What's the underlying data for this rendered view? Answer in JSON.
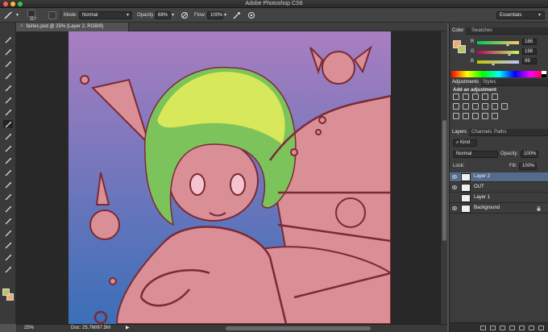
{
  "window": {
    "title": "Adobe Photoshop CS6",
    "traffic_colors": [
      "#fc5f57",
      "#fdbc2e",
      "#33c748"
    ]
  },
  "options_bar": {
    "brush_size": "117",
    "mode_label": "Mode:",
    "mode_value": "Normal",
    "opacity_label": "Opacity:",
    "opacity_value": "68%",
    "flow_label": "Flow:",
    "flow_value": "100%",
    "workspace": "Essentials"
  },
  "document": {
    "tab_label": "fairies.psd @ 25% (Layer 2, RGB/8)",
    "close_glyph": "×"
  },
  "status_bar": {
    "zoom": "25%",
    "doc_info": "Doc: 25.7M/87.5M",
    "arrow": "▶"
  },
  "color_panel": {
    "tabs": [
      "Color",
      "Swatches"
    ],
    "foreground_color": "#bcc463",
    "background_color": "#f2ab6e",
    "channels": [
      {
        "label": "R",
        "value": "188",
        "level": 0.737
      },
      {
        "label": "G",
        "value": "198",
        "level": 0.776
      },
      {
        "label": "B",
        "value": "99",
        "level": 0.388
      }
    ]
  },
  "adjustments_panel": {
    "tabs": [
      "Adjustments",
      "Styles"
    ],
    "heading": "Add an adjustment"
  },
  "layers_panel": {
    "tabs": [
      "Layers",
      "Channels",
      "Paths"
    ],
    "kind_filter": "Kind",
    "blend_mode": "Normal",
    "opacity_label": "Opacity:",
    "opacity_value": "100%",
    "lock_label": "Lock:",
    "fill_label": "Fill:",
    "fill_value": "100%",
    "layers": [
      {
        "name": "Layer 2",
        "visible": true,
        "active": true
      },
      {
        "name": "OUT",
        "visible": true,
        "active": false
      },
      {
        "name": "Layer 1",
        "visible": false,
        "active": false
      },
      {
        "name": "Background",
        "visible": true,
        "active": false,
        "locked": true
      }
    ]
  },
  "artwork_colors": {
    "sky_top": "#a97ec0",
    "sky_bottom": "#3a6fb8",
    "skin": "#d98f95",
    "hair_yellow": "#d7e85a",
    "hair_green": "#7cc35b",
    "line": "#7a2a35"
  }
}
